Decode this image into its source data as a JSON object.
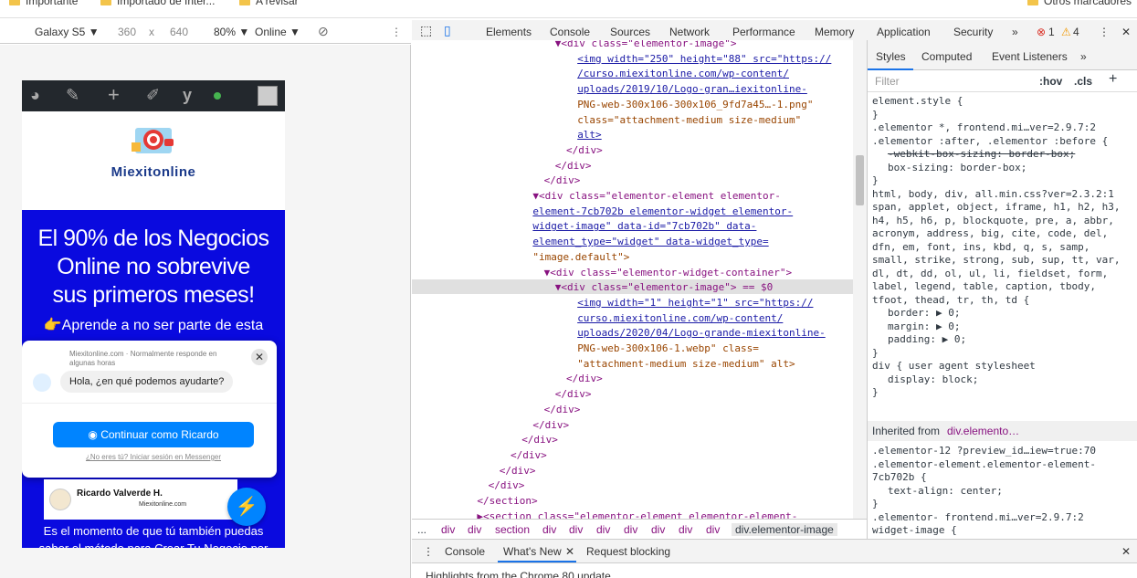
{
  "bookmarks": [
    "Importante",
    "Importado de Inter...",
    "A revisar",
    "Otros marcadores"
  ],
  "device_bar": {
    "device": "Galaxy S5 ▼",
    "width": "360",
    "times": "x",
    "height": "640",
    "zoom": "80% ▼",
    "network": "Online ▼"
  },
  "devtools_tabs": [
    "Elements",
    "Console",
    "Sources",
    "Network",
    "Performance",
    "Memory",
    "Application",
    "Security",
    "»"
  ],
  "devtools_status": {
    "errors": "1",
    "warnings": "4"
  },
  "site": {
    "logo_text": "Miexitonline",
    "hero": [
      "El 90% de los Negocios",
      "Online no sobrevive",
      "sus primeros meses!"
    ],
    "hero_sub": "👉Aprende a no ser parte de esta",
    "bottom_text": [
      "Es el momento de que tú también puedas",
      "saber el método para Crear Tu Negocio por"
    ],
    "card_name": "Ricardo Valverde H.",
    "card_site": "Miexitonline.com"
  },
  "chat": {
    "meta": "Miexitonline.com · Normalmente responde en algunas horas",
    "greeting": "Hola, ¿en qué podemos ayudarte?",
    "cta": "Continuar como Ricardo",
    "alt": "¿No eres tú? Iniciar sesión en Messenger",
    "close": "✕"
  },
  "dom_lines": [
    {
      "indent": 14,
      "html": "▼<div class=\"elementor-image\">"
    },
    {
      "indent": 16,
      "html": "<img width=\"250\" height=\"88\" src=\"https://"
    },
    {
      "indent": 16,
      "html": "/curso.miexitonline.com/wp-content/"
    },
    {
      "indent": 16,
      "html": "uploads/2019/10/Logo-gran…iexitonline-"
    },
    {
      "indent": 16,
      "html": "PNG-web-300x106-300x106_9fd7a45…-1.png\""
    },
    {
      "indent": 16,
      "html": "class=\"attachment-medium size-medium\""
    },
    {
      "indent": 16,
      "html": "alt>"
    },
    {
      "indent": 15,
      "html": "</div>"
    },
    {
      "indent": 14,
      "html": "</div>"
    },
    {
      "indent": 13,
      "html": "</div>"
    },
    {
      "indent": 12,
      "html": "▼<div class=\"elementor-element elementor-"
    },
    {
      "indent": 12,
      "html": "element-7cb702b elementor-widget elementor-"
    },
    {
      "indent": 12,
      "html": "widget-image\" data-id=\"7cb702b\" data-"
    },
    {
      "indent": 12,
      "html": "element_type=\"widget\" data-widget_type="
    },
    {
      "indent": 12,
      "html": "\"image.default\">"
    },
    {
      "indent": 13,
      "html": "▼<div class=\"elementor-widget-container\">"
    },
    {
      "indent": 14,
      "html": "▼<div class=\"elementor-image\"> == $0"
    },
    {
      "indent": 16,
      "html": "<img width=\"1\" height=\"1\" src=\"https://"
    },
    {
      "indent": 16,
      "html": "curso.miexitonline.com/wp-content/"
    },
    {
      "indent": 16,
      "html": "uploads/2020/04/Logo-grande-miexitonline-"
    },
    {
      "indent": 16,
      "html": "PNG-web-300x106-1.webp\" class="
    },
    {
      "indent": 16,
      "html": "\"attachment-medium size-medium\" alt>"
    },
    {
      "indent": 15,
      "html": "</div>"
    },
    {
      "indent": 14,
      "html": "</div>"
    },
    {
      "indent": 13,
      "html": "</div>"
    },
    {
      "indent": 12,
      "html": "</div>"
    },
    {
      "indent": 11,
      "html": "</div>"
    },
    {
      "indent": 10,
      "html": "</div>"
    },
    {
      "indent": 9,
      "html": "</div>"
    },
    {
      "indent": 8,
      "html": "</div>"
    },
    {
      "indent": 7,
      "html": "</section>"
    },
    {
      "indent": 7,
      "html": "▶<section class=\"elementor-element elementor-element-"
    }
  ],
  "breadcrumbs": [
    "...",
    "div",
    "div",
    "section",
    "div",
    "div",
    "div",
    "div",
    "div",
    "div",
    "div",
    "div.elementor-image"
  ],
  "styles_tabs": [
    "Styles",
    "Computed",
    "Event Listeners",
    "»"
  ],
  "styles_filter": {
    "placeholder": "Filter",
    "hov": ":hov",
    "cls": ".cls",
    "plus": "+"
  },
  "styles_lines": [
    "element.style {",
    "}",
    ".elementor *,        frontend.mi…ver=2.9.7:2",
    ".elementor :after, .elementor :before {",
    "  -webkit-box-sizing: border-box;",
    "  box-sizing: border-box;",
    "}",
    "html, body, div,     all.min.css?ver=2.3.2:1",
    "span, applet, object, iframe, h1, h2, h3,",
    "h4, h5, h6, p, blockquote, pre, a, abbr,",
    "acronym, address, big, cite, code, del,",
    "dfn, em, font, ins, kbd, q, s, samp,",
    "small, strike, strong, sub, sup, tt, var,",
    "dl, dt, dd, ol, ul, li, fieldset, form,",
    "label, legend, table, caption, tbody,",
    "tfoot, thead, tr, th, td {",
    "  border: ▶ 0;",
    "  margin: ▶ 0;",
    "  padding: ▶ 0;",
    "}",
    "div {               user agent stylesheet",
    "  display: block;",
    "}"
  ],
  "inherited": {
    "label": "Inherited from",
    "target": "div.elemento…"
  },
  "styles_lines_2": [
    ".elementor-12        ?preview_id…iew=true:70",
    ".elementor-element.elementor-element-",
    "7cb702b {",
    "  text-align: center;",
    "}",
    ".elementor-          frontend.mi…ver=2.9.7:2",
    "widget-image {"
  ],
  "drawer": {
    "tabs": [
      "Console",
      "What's New",
      "Request blocking"
    ],
    "content": "Highlights from the Chrome 80 update"
  }
}
